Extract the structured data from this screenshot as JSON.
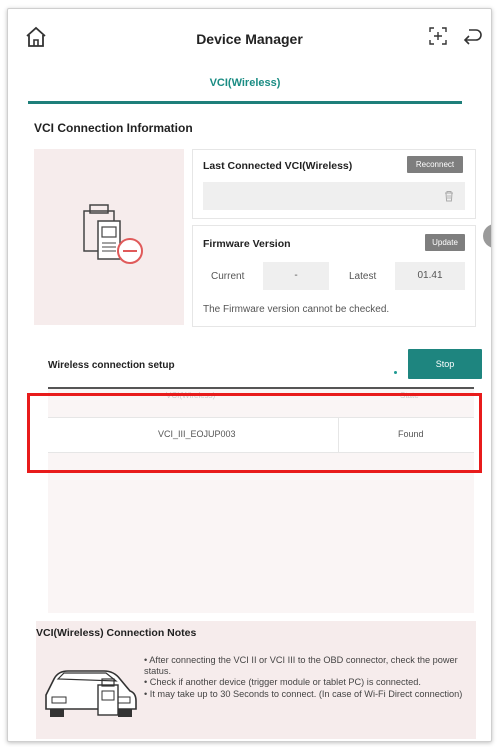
{
  "header": {
    "title": "Device Manager",
    "home_icon": "home-icon",
    "add_icon": "add-device-icon",
    "back_icon": "back-icon"
  },
  "tab": {
    "label": "VCI(Wireless)"
  },
  "connection_info": {
    "section_title": "VCI Connection Information",
    "last_connected_label": "Last Connected VCI(Wireless)",
    "reconnect_label": "Reconnect",
    "last_connected_value": "",
    "firmware_label": "Firmware Version",
    "update_label": "Update",
    "current_label": "Current",
    "current_value": "-",
    "latest_label": "Latest",
    "latest_value": "01.41",
    "note": "The Firmware version cannot be checked."
  },
  "wireless_setup": {
    "title": "Wireless connection setup",
    "stop_label": "Stop",
    "columns": [
      "VCI(Wireless)",
      "State"
    ],
    "rows": [
      {
        "name": "VCI_III_EOJUP003",
        "state": "Found"
      }
    ]
  },
  "notes": {
    "title": "VCI(Wireless) Connection Notes",
    "items": [
      "• After connecting the VCI II or VCI III to the OBD connector, check the power status.",
      "• Check if another device (trigger module or tablet PC) is connected.",
      "• It may take up to 30 Seconds to connect. (In case of Wi-Fi Direct connection)"
    ]
  },
  "colors": {
    "accent": "#1e857f",
    "highlight": "#e81b1b",
    "panel_bg": "#f6ecec"
  }
}
